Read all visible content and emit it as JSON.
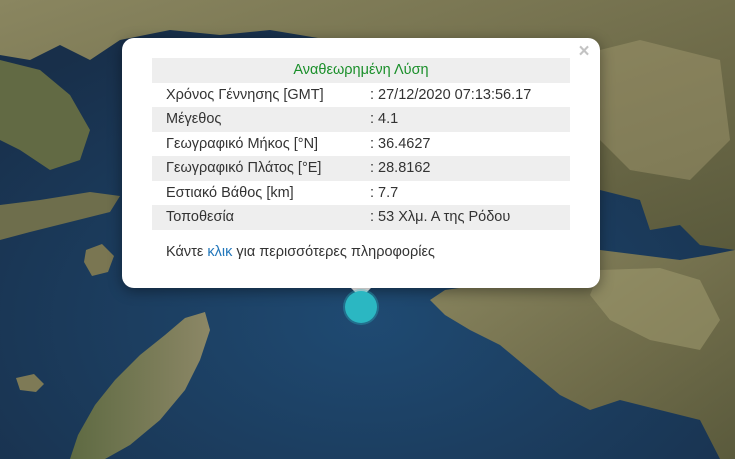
{
  "map": {
    "colors": {
      "sea": "#1d3a5a",
      "land": "#6b6a4a",
      "land_light": "#9a9468"
    },
    "marker_color": "#2bb7c2"
  },
  "popup": {
    "close_symbol": "×",
    "title": "Αναθεωρημένη Λύση",
    "rows": [
      {
        "label": "Χρόνος Γέννησης [GMT]",
        "value": ": 27/12/2020 07:13:56.17"
      },
      {
        "label": "Μέγεθος",
        "value": ": 4.1"
      },
      {
        "label": "Γεωγραφικό Μήκος [°N]",
        "value": ": 36.4627"
      },
      {
        "label": "Γεωγραφικό Πλάτος [°E]",
        "value": ": 28.8162"
      },
      {
        "label": "Εστιακό Βάθος [km]",
        "value": ": 7.7"
      },
      {
        "label": "Τοποθεσία",
        "value": ": 53 Χλμ. Α της Ρόδου"
      }
    ],
    "more_prefix": "Κάντε ",
    "more_link": "κλικ",
    "more_suffix": " για περισσότερες πληροφορίες",
    "title_color": "#1a8f2a",
    "link_color": "#2277bb"
  }
}
